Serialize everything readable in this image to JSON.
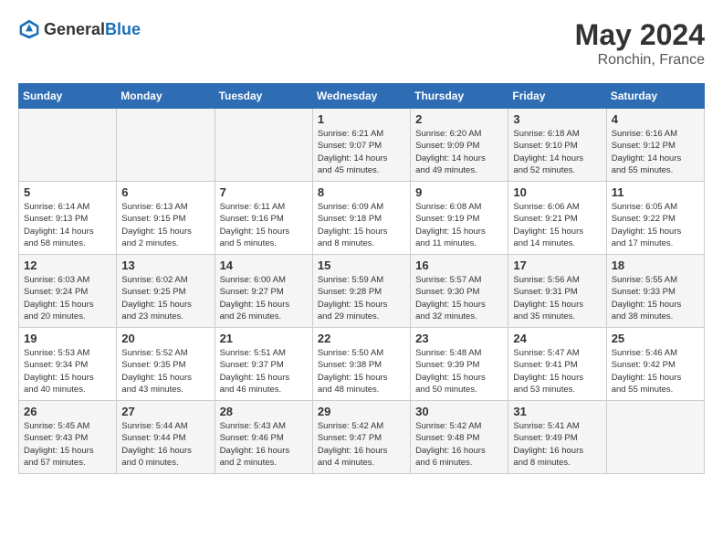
{
  "header": {
    "logo_general": "General",
    "logo_blue": "Blue",
    "month_year": "May 2024",
    "location": "Ronchin, France"
  },
  "days_of_week": [
    "Sunday",
    "Monday",
    "Tuesday",
    "Wednesday",
    "Thursday",
    "Friday",
    "Saturday"
  ],
  "weeks": [
    [
      {
        "day": "",
        "info": ""
      },
      {
        "day": "",
        "info": ""
      },
      {
        "day": "",
        "info": ""
      },
      {
        "day": "1",
        "info": "Sunrise: 6:21 AM\nSunset: 9:07 PM\nDaylight: 14 hours\nand 45 minutes."
      },
      {
        "day": "2",
        "info": "Sunrise: 6:20 AM\nSunset: 9:09 PM\nDaylight: 14 hours\nand 49 minutes."
      },
      {
        "day": "3",
        "info": "Sunrise: 6:18 AM\nSunset: 9:10 PM\nDaylight: 14 hours\nand 52 minutes."
      },
      {
        "day": "4",
        "info": "Sunrise: 6:16 AM\nSunset: 9:12 PM\nDaylight: 14 hours\nand 55 minutes."
      }
    ],
    [
      {
        "day": "5",
        "info": "Sunrise: 6:14 AM\nSunset: 9:13 PM\nDaylight: 14 hours\nand 58 minutes."
      },
      {
        "day": "6",
        "info": "Sunrise: 6:13 AM\nSunset: 9:15 PM\nDaylight: 15 hours\nand 2 minutes."
      },
      {
        "day": "7",
        "info": "Sunrise: 6:11 AM\nSunset: 9:16 PM\nDaylight: 15 hours\nand 5 minutes."
      },
      {
        "day": "8",
        "info": "Sunrise: 6:09 AM\nSunset: 9:18 PM\nDaylight: 15 hours\nand 8 minutes."
      },
      {
        "day": "9",
        "info": "Sunrise: 6:08 AM\nSunset: 9:19 PM\nDaylight: 15 hours\nand 11 minutes."
      },
      {
        "day": "10",
        "info": "Sunrise: 6:06 AM\nSunset: 9:21 PM\nDaylight: 15 hours\nand 14 minutes."
      },
      {
        "day": "11",
        "info": "Sunrise: 6:05 AM\nSunset: 9:22 PM\nDaylight: 15 hours\nand 17 minutes."
      }
    ],
    [
      {
        "day": "12",
        "info": "Sunrise: 6:03 AM\nSunset: 9:24 PM\nDaylight: 15 hours\nand 20 minutes."
      },
      {
        "day": "13",
        "info": "Sunrise: 6:02 AM\nSunset: 9:25 PM\nDaylight: 15 hours\nand 23 minutes."
      },
      {
        "day": "14",
        "info": "Sunrise: 6:00 AM\nSunset: 9:27 PM\nDaylight: 15 hours\nand 26 minutes."
      },
      {
        "day": "15",
        "info": "Sunrise: 5:59 AM\nSunset: 9:28 PM\nDaylight: 15 hours\nand 29 minutes."
      },
      {
        "day": "16",
        "info": "Sunrise: 5:57 AM\nSunset: 9:30 PM\nDaylight: 15 hours\nand 32 minutes."
      },
      {
        "day": "17",
        "info": "Sunrise: 5:56 AM\nSunset: 9:31 PM\nDaylight: 15 hours\nand 35 minutes."
      },
      {
        "day": "18",
        "info": "Sunrise: 5:55 AM\nSunset: 9:33 PM\nDaylight: 15 hours\nand 38 minutes."
      }
    ],
    [
      {
        "day": "19",
        "info": "Sunrise: 5:53 AM\nSunset: 9:34 PM\nDaylight: 15 hours\nand 40 minutes."
      },
      {
        "day": "20",
        "info": "Sunrise: 5:52 AM\nSunset: 9:35 PM\nDaylight: 15 hours\nand 43 minutes."
      },
      {
        "day": "21",
        "info": "Sunrise: 5:51 AM\nSunset: 9:37 PM\nDaylight: 15 hours\nand 46 minutes."
      },
      {
        "day": "22",
        "info": "Sunrise: 5:50 AM\nSunset: 9:38 PM\nDaylight: 15 hours\nand 48 minutes."
      },
      {
        "day": "23",
        "info": "Sunrise: 5:48 AM\nSunset: 9:39 PM\nDaylight: 15 hours\nand 50 minutes."
      },
      {
        "day": "24",
        "info": "Sunrise: 5:47 AM\nSunset: 9:41 PM\nDaylight: 15 hours\nand 53 minutes."
      },
      {
        "day": "25",
        "info": "Sunrise: 5:46 AM\nSunset: 9:42 PM\nDaylight: 15 hours\nand 55 minutes."
      }
    ],
    [
      {
        "day": "26",
        "info": "Sunrise: 5:45 AM\nSunset: 9:43 PM\nDaylight: 15 hours\nand 57 minutes."
      },
      {
        "day": "27",
        "info": "Sunrise: 5:44 AM\nSunset: 9:44 PM\nDaylight: 16 hours\nand 0 minutes."
      },
      {
        "day": "28",
        "info": "Sunrise: 5:43 AM\nSunset: 9:46 PM\nDaylight: 16 hours\nand 2 minutes."
      },
      {
        "day": "29",
        "info": "Sunrise: 5:42 AM\nSunset: 9:47 PM\nDaylight: 16 hours\nand 4 minutes."
      },
      {
        "day": "30",
        "info": "Sunrise: 5:42 AM\nSunset: 9:48 PM\nDaylight: 16 hours\nand 6 minutes."
      },
      {
        "day": "31",
        "info": "Sunrise: 5:41 AM\nSunset: 9:49 PM\nDaylight: 16 hours\nand 8 minutes."
      },
      {
        "day": "",
        "info": ""
      }
    ]
  ]
}
